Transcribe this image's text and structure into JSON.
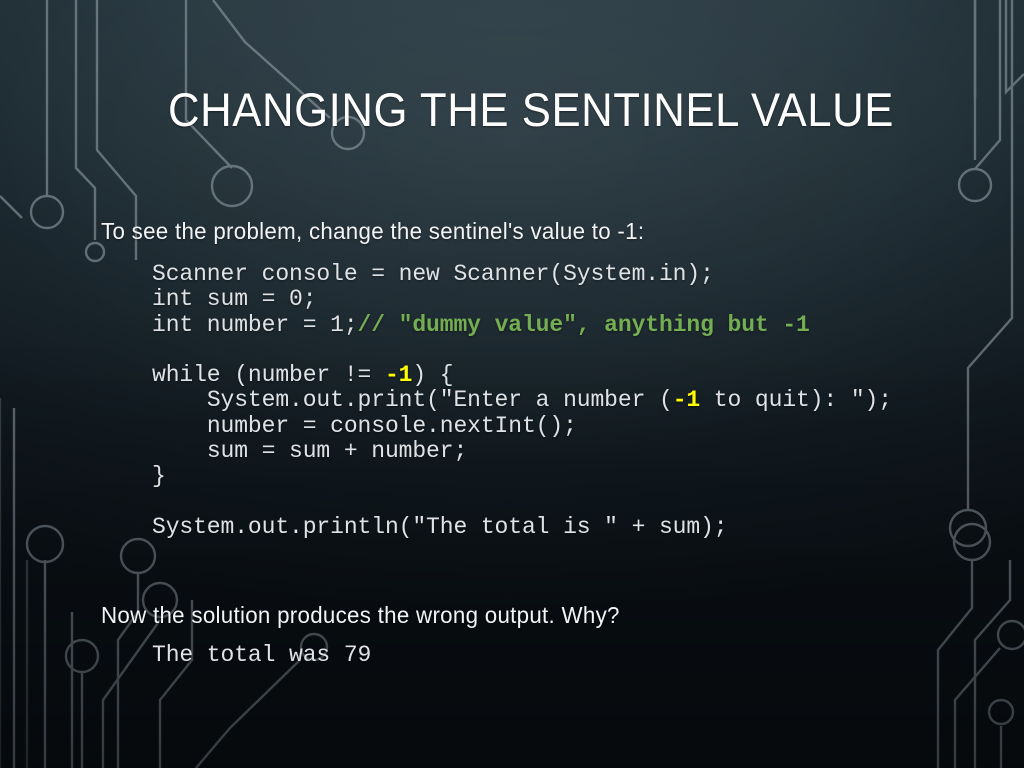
{
  "slide": {
    "title": "CHANGING THE SENTINEL VALUE",
    "lead_text": "To see the problem, change the sentinel's value to -1:",
    "question_text": "Now the solution produces the wrong output.  Why?",
    "output_text": "The total was 79"
  },
  "code": {
    "line1": "Scanner console = new Scanner(System.in);",
    "line2": "int sum = 0;",
    "line3_prefix": "int number = 1;",
    "line3_comment": "// \"dummy value\", anything but -1",
    "line4_blank": "",
    "line5_prefix": "while (number != ",
    "line5_sentinel": "-1",
    "line5_suffix": ") {",
    "line6_prefix": "    System.out.print(\"Enter a number (",
    "line6_sentinel": "-1",
    "line6_suffix": " to quit): \");",
    "line7": "    number = console.nextInt();",
    "line8": "    sum = sum + number;",
    "line9": "}",
    "line10_blank": "",
    "line11": "System.out.println(\"The total is \" + sum);"
  },
  "colors": {
    "background_top": "#2a3a42",
    "background_bottom": "#0b1116",
    "title_text": "#fdfdfd",
    "body_text": "#f2f4f5",
    "code_text": "#dfe3e6",
    "comment_green": "#74ad52",
    "sentinel_yellow": "#ffff00",
    "circuit_trace": "#8d9aa2"
  },
  "decoration": {
    "name": "circuit-board-traces",
    "description": "thin light gray circuit traces with circular node terminals along left and right edges"
  }
}
